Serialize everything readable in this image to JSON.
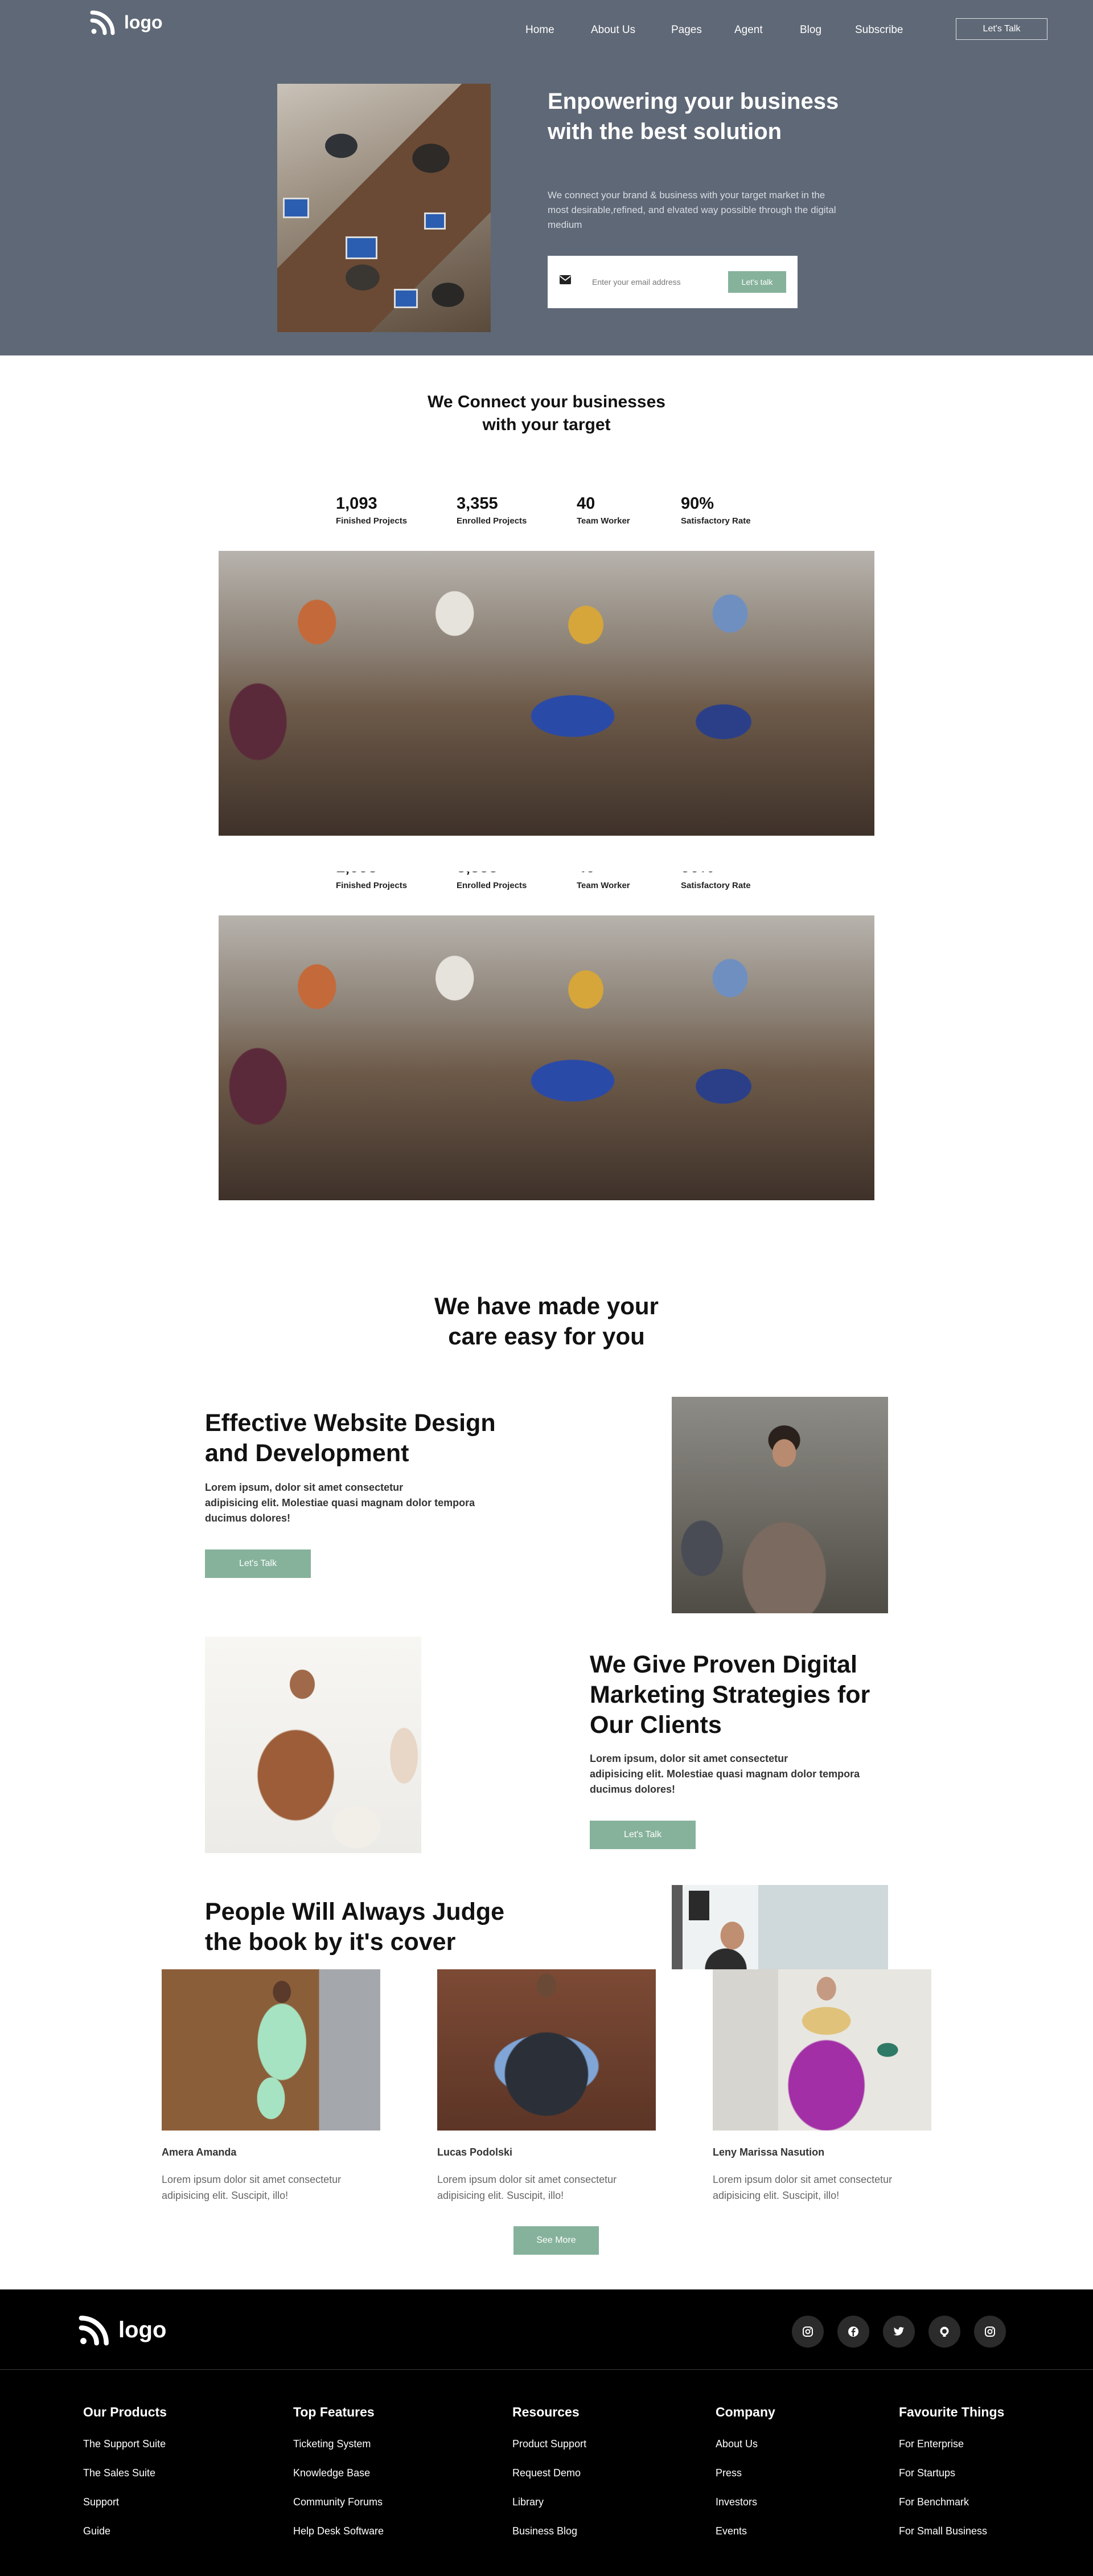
{
  "header": {
    "logo_text": "logo",
    "nav": [
      "Home",
      "About Us",
      "Pages",
      "Agent",
      "Blog",
      "Subscribe"
    ],
    "cta_label": "Let's Talk"
  },
  "hero": {
    "title": "Enpowering your business with the best solution",
    "description": "We connect your brand & business with your target market in the most desirable,refined, and elvated way possible through the digital medium",
    "email_placeholder": "Enter your email address",
    "email_button": "Let's talk",
    "mail_icon": "envelope-icon"
  },
  "connect": {
    "title_line1": "We Connect your businesses",
    "title_line2": "with your target",
    "stats": [
      {
        "value": "1,093",
        "label": "Finished Projects"
      },
      {
        "value": "3,355",
        "label": "Enrolled Projects"
      },
      {
        "value": "40",
        "label": "Team Worker"
      },
      {
        "value": "90%",
        "label": "Satisfactory Rate"
      }
    ]
  },
  "care": {
    "title_line1": "We have made your",
    "title_line2": "care easy for you"
  },
  "features": [
    {
      "title_line1": "Effective Website Design",
      "title_line2": "and Development",
      "text_line1": "Lorem ipsum, dolor sit amet consectetur",
      "text_line2": "adipisicing elit. Molestiae quasi magnam dolor tempora",
      "text_line3": "ducimus dolores!",
      "button": "Let's Talk"
    },
    {
      "title_line1": "We Give Proven Digital",
      "title_line2": "Marketing Strategies for",
      "title_line3": "Our Clients",
      "text_line1": "Lorem ipsum, dolor sit amet consectetur",
      "text_line2": "adipisicing elit. Molestiae quasi magnam dolor tempora",
      "text_line3": "ducimus dolores!",
      "button": "Let's Talk"
    },
    {
      "title_line1": "People Will Always Judge",
      "title_line2": "the book by it's cover"
    }
  ],
  "team": {
    "members": [
      {
        "name": "Amera Amanda",
        "desc_line1": "Lorem ipsum dolor sit amet consectetur",
        "desc_line2": "adipisicing elit. Suscipit, illo!"
      },
      {
        "name": "Lucas Podolski",
        "desc_line1": "Lorem ipsum dolor sit amet consectetur",
        "desc_line2": "adipisicing elit. Suscipit, illo!"
      },
      {
        "name": "Leny Marissa Nasution",
        "desc_line1": "Lorem ipsum dolor sit amet consectetur",
        "desc_line2": "adipisicing elit. Suscipit, illo!"
      }
    ],
    "see_more": "See More"
  },
  "footer": {
    "logo_text": "logo",
    "social_icons": [
      "instagram-icon",
      "facebook-icon",
      "twitter-icon",
      "github-icon",
      "instagram-icon"
    ],
    "columns": [
      {
        "heading": "Our Products",
        "links": [
          "The Support Suite",
          "The Sales Suite",
          "Support",
          "Guide"
        ]
      },
      {
        "heading": "Top Features",
        "links": [
          "Ticketing System",
          "Knowledge Base",
          "Community Forums",
          "Help Desk Software"
        ]
      },
      {
        "heading": "Resources",
        "links": [
          "Product Support",
          "Request Demo",
          "Library",
          "Business Blog"
        ]
      },
      {
        "heading": "Company",
        "links": [
          "About Us",
          "Press",
          "Investors",
          "Events"
        ]
      },
      {
        "heading": "Favourite Things",
        "links": [
          "For Enterprise",
          "For Startups",
          "For Benchmark",
          "For Small Business"
        ]
      }
    ]
  },
  "colors": {
    "hero_bg": "#5f6876",
    "accent_green": "#86b29b",
    "footer_bg": "#000000"
  }
}
